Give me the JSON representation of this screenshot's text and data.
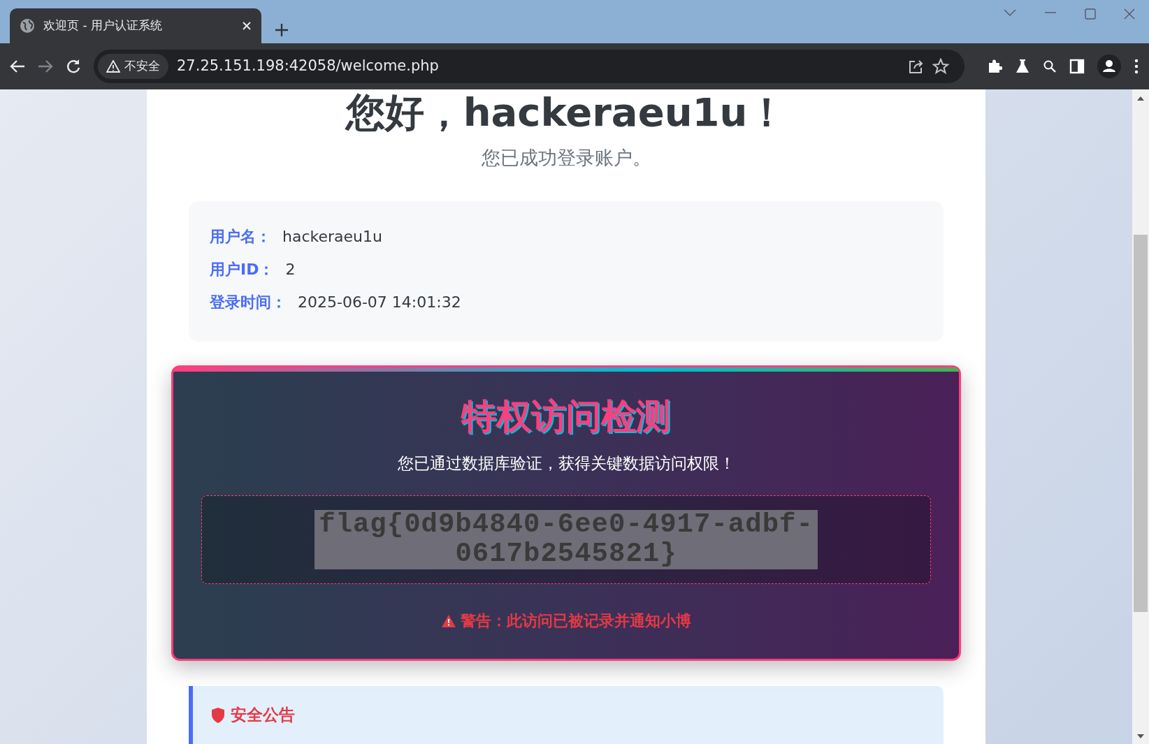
{
  "browser": {
    "tab": {
      "title": "欢迎页 - 用户认证系统",
      "selected": true
    },
    "security_label": "不安全",
    "url": "27.25.151.198:42058/welcome.php"
  },
  "greeting": {
    "title": "您好，hackeraeu1u！",
    "subtitle": "您已成功登录账户。"
  },
  "user_info": [
    {
      "label": "用户名：",
      "value": "hackeraeu1u"
    },
    {
      "label": "用户ID：",
      "value": "2"
    },
    {
      "label": "登录时间：",
      "value": "2025-06-07 14:01:32"
    }
  ],
  "privilege_panel": {
    "title": "特权访问检测",
    "message": "您已通过数据库验证，获得关键数据访问权限！",
    "flag": "flag{0d9b4840-6ee0-4917-adbf-0617b2545821}",
    "warning": "警告：此访问已被记录并通知小博"
  },
  "notice": {
    "title": "安全公告"
  }
}
